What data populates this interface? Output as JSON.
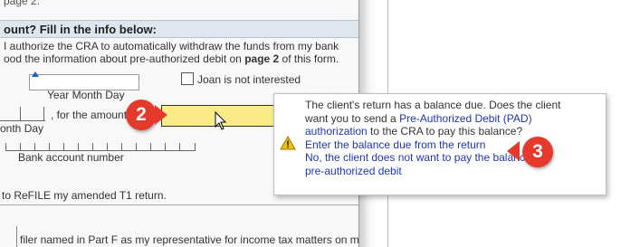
{
  "form": {
    "page_ref": "page 2.",
    "section_heading": "ount? Fill in the info below:",
    "authorize_line1": "I authorize the CRA to automatically withdraw the funds from my bank",
    "authorize_line2_prefix": "ood the information about pre-authorized debit on ",
    "authorize_line2_bold": "page 2",
    "authorize_line2_suffix": " of this form.",
    "date_label": "Year Month Day",
    "checkbox_label": "Joan is not interested",
    "amount_label": ", for the amount",
    "month_day_label": "onth Day",
    "bank_account_label": "Bank account number",
    "refile_text": "to ReFILE my amended T1 return.",
    "bottom_text": "filer named in Part F as my representative for income tax matters on my"
  },
  "tooltip": {
    "message_line1": "The client's return has a balance due. Does the client",
    "message_line2_prefix": "want you to send a ",
    "message_link1": "Pre-Authorized Debit (PAD)",
    "message_link2": "authorization",
    "message_line3_suffix": " to the CRA to pay this balance?",
    "option1": "Enter the balance due from the return",
    "option2_line1": "No, the client does not want to pay the balance by",
    "option2_line2": "pre-authorized debit"
  },
  "badges": {
    "badge2": "2",
    "badge3": "3"
  },
  "colors": {
    "badge": "#e5392c",
    "highlight_field": "#fbeb86",
    "link": "#1f36b5",
    "warning": "#f2c200"
  },
  "icons": {
    "warning": "warning-icon",
    "cursor": "mouse-cursor-icon",
    "date_marker": "caret-marker-icon"
  }
}
